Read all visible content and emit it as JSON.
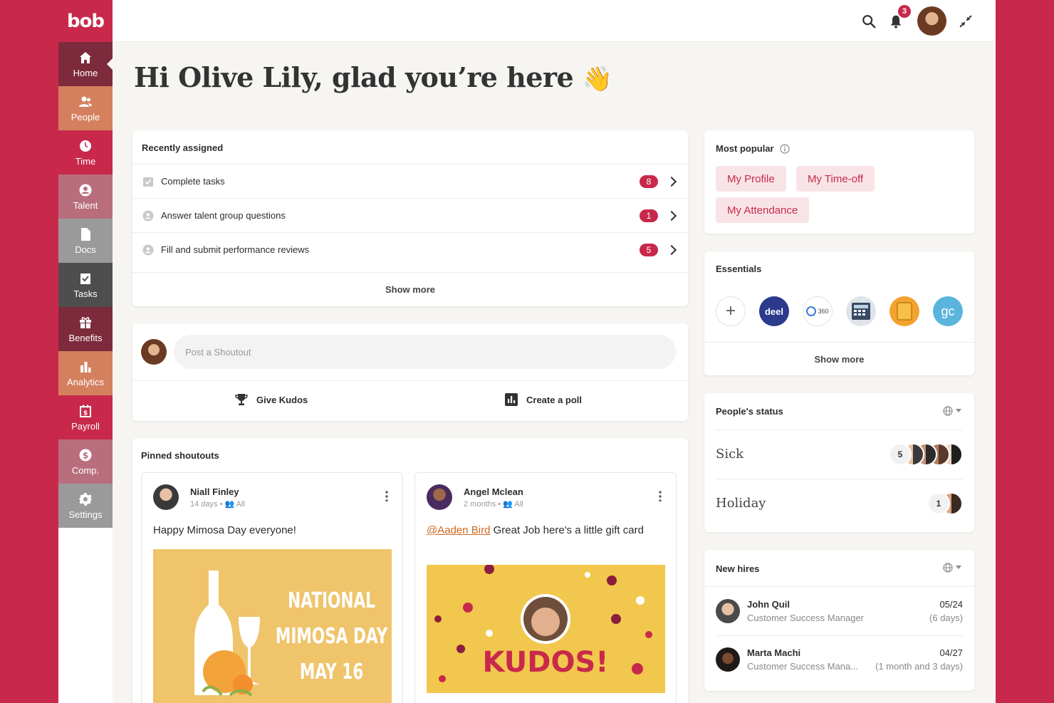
{
  "app": {
    "logo": "bob"
  },
  "sidebar": {
    "items": [
      {
        "label": "Home",
        "icon": "home-icon",
        "color": "#7d2a3c"
      },
      {
        "label": "People",
        "icon": "people-icon",
        "color": "#d4805e"
      },
      {
        "label": "Time",
        "icon": "clock-icon",
        "color": "#c8294b"
      },
      {
        "label": "Talent",
        "icon": "talent-icon",
        "color": "#b96e7e"
      },
      {
        "label": "Docs",
        "icon": "document-icon",
        "color": "#9a9a9a"
      },
      {
        "label": "Tasks",
        "icon": "tasks-icon",
        "color": "#4e4e4e"
      },
      {
        "label": "Benefits",
        "icon": "gift-icon",
        "color": "#7d2a3c"
      },
      {
        "label": "Analytics",
        "icon": "analytics-icon",
        "color": "#d4805e"
      },
      {
        "label": "Payroll",
        "icon": "payroll-icon",
        "color": "#c8294b"
      },
      {
        "label": "Comp.",
        "icon": "dollar-icon",
        "color": "#b96e7e"
      },
      {
        "label": "Settings",
        "icon": "gear-icon",
        "color": "#9a9a9a"
      }
    ]
  },
  "topbar": {
    "notifications_count": "3"
  },
  "greeting": {
    "text": "Hi Olive Lily, glad you’re here",
    "emoji": "👋"
  },
  "recently_assigned": {
    "title": "Recently assigned",
    "items": [
      {
        "label": "Complete tasks",
        "count": "8"
      },
      {
        "label": "Answer talent group questions",
        "count": "1"
      },
      {
        "label": "Fill and submit performance reviews",
        "count": "5"
      }
    ],
    "show_more": "Show more"
  },
  "shoutout": {
    "placeholder": "Post a Shoutout",
    "give_kudos": "Give Kudos",
    "create_poll": "Create a poll"
  },
  "pinned": {
    "title": "Pinned shoutouts",
    "posts": [
      {
        "author": "Niall Finley",
        "time": "14 days",
        "audience": "All",
        "text": "Happy Mimosa Day everyone!",
        "image_lines": [
          "NATIONAL",
          "MIMOSA DAY",
          "MAY 16"
        ]
      },
      {
        "author": "Angel Mclean",
        "time": "2 months",
        "audience": "All",
        "mention": "@Aaden Bird",
        "text": " Great Job here's a little gift card",
        "image_text": "KUDOS!"
      }
    ]
  },
  "most_popular": {
    "title": "Most popular",
    "links": [
      "My Profile",
      "My Time-off",
      "My Attendance"
    ]
  },
  "essentials": {
    "title": "Essentials",
    "apps": [
      {
        "label": "deel",
        "icon": "deel-icon"
      },
      {
        "label": "360",
        "icon": "360-icon"
      },
      {
        "label": "",
        "icon": "calculator-icon"
      },
      {
        "label": "",
        "icon": "notebook-icon"
      },
      {
        "label": "gc",
        "icon": "gc-icon"
      }
    ],
    "show_more": "Show more"
  },
  "people_status": {
    "title": "People's status",
    "rows": [
      {
        "label": "Sick",
        "count": "5"
      },
      {
        "label": "Holiday",
        "count": "1"
      }
    ]
  },
  "new_hires": {
    "title": "New hires",
    "people": [
      {
        "name": "John Quil",
        "role": "Customer Success Manager",
        "date": "05/24",
        "ago": "(6 days)"
      },
      {
        "name": "Marta Machi",
        "role": "Customer Success Mana...",
        "date": "04/27",
        "ago": "(1 month and 3 days)"
      }
    ]
  }
}
